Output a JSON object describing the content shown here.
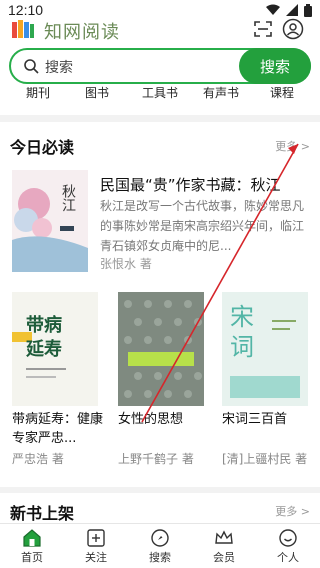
{
  "status_bar": {
    "time": "12:10"
  },
  "header": {
    "app_name": "知网阅读",
    "search_placeholder": "搜索",
    "search_button": "搜索",
    "categories": [
      "期刊",
      "图书",
      "工具书",
      "有声书",
      "课程"
    ]
  },
  "today": {
    "title": "今日必读",
    "more": "更多 >",
    "featured": {
      "title": "民国最“贵”作家书藏：秋江",
      "description": "秋江是改写一个古代故事，陈妙常思凡的事陈妙常是南宋高宗绍兴年间，临江青石镇郊女贞庵中的尼...",
      "author": "张恨水 著",
      "cover_text": "秋江"
    },
    "books": [
      {
        "title": "带病延寿：健康专家严忠...",
        "author": "严忠浩 著",
        "cover_text": "带病延寿"
      },
      {
        "title": "女性的思想",
        "author": "上野千鹤子 著",
        "cover_text": "女性的思想"
      },
      {
        "title": "宋词三百首",
        "author": "[清]上疆村民 著",
        "cover_text": "宋词"
      }
    ]
  },
  "new_books": {
    "title": "新书上架",
    "more": "更多 >"
  },
  "tabbar": {
    "items": [
      "首页",
      "关注",
      "搜索",
      "会员",
      "个人"
    ]
  },
  "colors": {
    "accent": "#23a03d",
    "annotation": "#d6262b"
  }
}
